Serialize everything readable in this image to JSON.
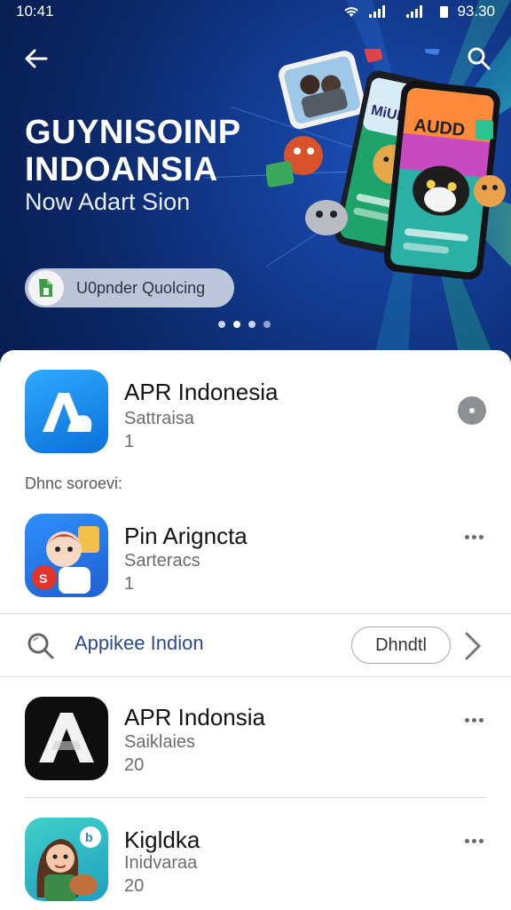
{
  "status_bar": {
    "time": "10:41",
    "battery": "93.30"
  },
  "hero": {
    "title": "GUYNISOINP INDOANSIA",
    "subtitle": "Now Adart Sion",
    "chip_label": "U0pnder Quolcing",
    "phone_screen_1": "MiUDD",
    "phone_screen_2": "AUDD",
    "carousel_pages": 4,
    "carousel_active": 2
  },
  "apps": [
    {
      "name": "APR Indonesia",
      "subtitle": "Sattraisa",
      "number": "1",
      "icon": "blue-a-app-icon"
    },
    {
      "name": "Pin Arigncta",
      "subtitle": "Sarteracs",
      "number": "1",
      "icon": "cartoon-kid-app-icon"
    },
    {
      "name": "APR Indonsia",
      "subtitle": "Saiklaies",
      "number": "20",
      "icon": "black-a-app-icon"
    },
    {
      "name": "Kigldka",
      "subtitle": "Inidvaraa",
      "number": "20",
      "icon": "woman-cartoon-app-icon"
    }
  ],
  "section_label": "Dhnc soroevi:",
  "search_strip": {
    "label": "Appikee Indion",
    "button": "Dhndtl"
  },
  "colors": {
    "hero_bg": "#0b2766",
    "accent_blue": "#2d4a8a",
    "app_blue": "#1a8ff0"
  }
}
